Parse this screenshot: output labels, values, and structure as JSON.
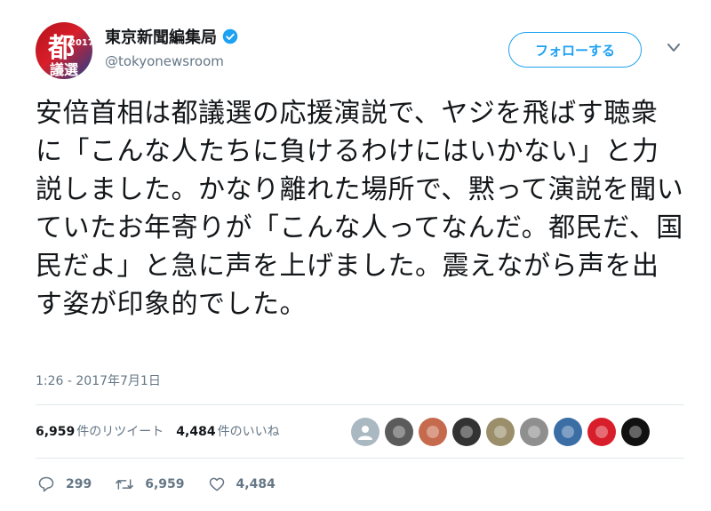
{
  "author": {
    "display_name": "東京新聞編集局",
    "handle": "@tokyonewsroom",
    "avatar_text_large": "都",
    "avatar_text_year": "2017",
    "avatar_text_small": "議選",
    "verified": true
  },
  "follow_button": {
    "label": "フォローする"
  },
  "tweet": {
    "text": "安倍首相は都議選の応援演説で、ヤジを飛ばす聴衆に「こんな人たちに負けるわけにはいかない」と力説しました。かなり離れた場所で、黙って演説を聞いていたお年寄りが「こんな人ってなんだ。都民だ、国民だよ」と急に声を上げました。震えながら声を出す姿が印象的でした。",
    "timestamp": "1:26 - 2017年7月1日"
  },
  "stats": {
    "retweets_count": "6,959",
    "retweets_label": "件のリツイート",
    "likes_count": "4,484",
    "likes_label": "件のいいね"
  },
  "actions": {
    "reply_count": "299",
    "retweet_count": "6,959",
    "like_count": "4,484"
  },
  "colors": {
    "accent": "#1da1f2",
    "text": "#14171a",
    "muted": "#657786",
    "divider": "#e1e8ed"
  },
  "liker_avatars": [
    {
      "icon": "default-user-icon",
      "color": "#aab8c2"
    },
    {
      "icon": "photo-avatar-icon",
      "color": "#5b5b5b"
    },
    {
      "icon": "photo-avatar-icon",
      "color": "#c66a4e"
    },
    {
      "icon": "photo-avatar-icon",
      "color": "#333333"
    },
    {
      "icon": "photo-avatar-icon",
      "color": "#9a8f6a"
    },
    {
      "icon": "photo-avatar-icon",
      "color": "#8f8f8f"
    },
    {
      "icon": "photo-avatar-icon",
      "color": "#3b6ea5"
    },
    {
      "icon": "photo-avatar-icon",
      "color": "#d81e2a"
    },
    {
      "icon": "photo-avatar-icon",
      "color": "#111111"
    }
  ]
}
